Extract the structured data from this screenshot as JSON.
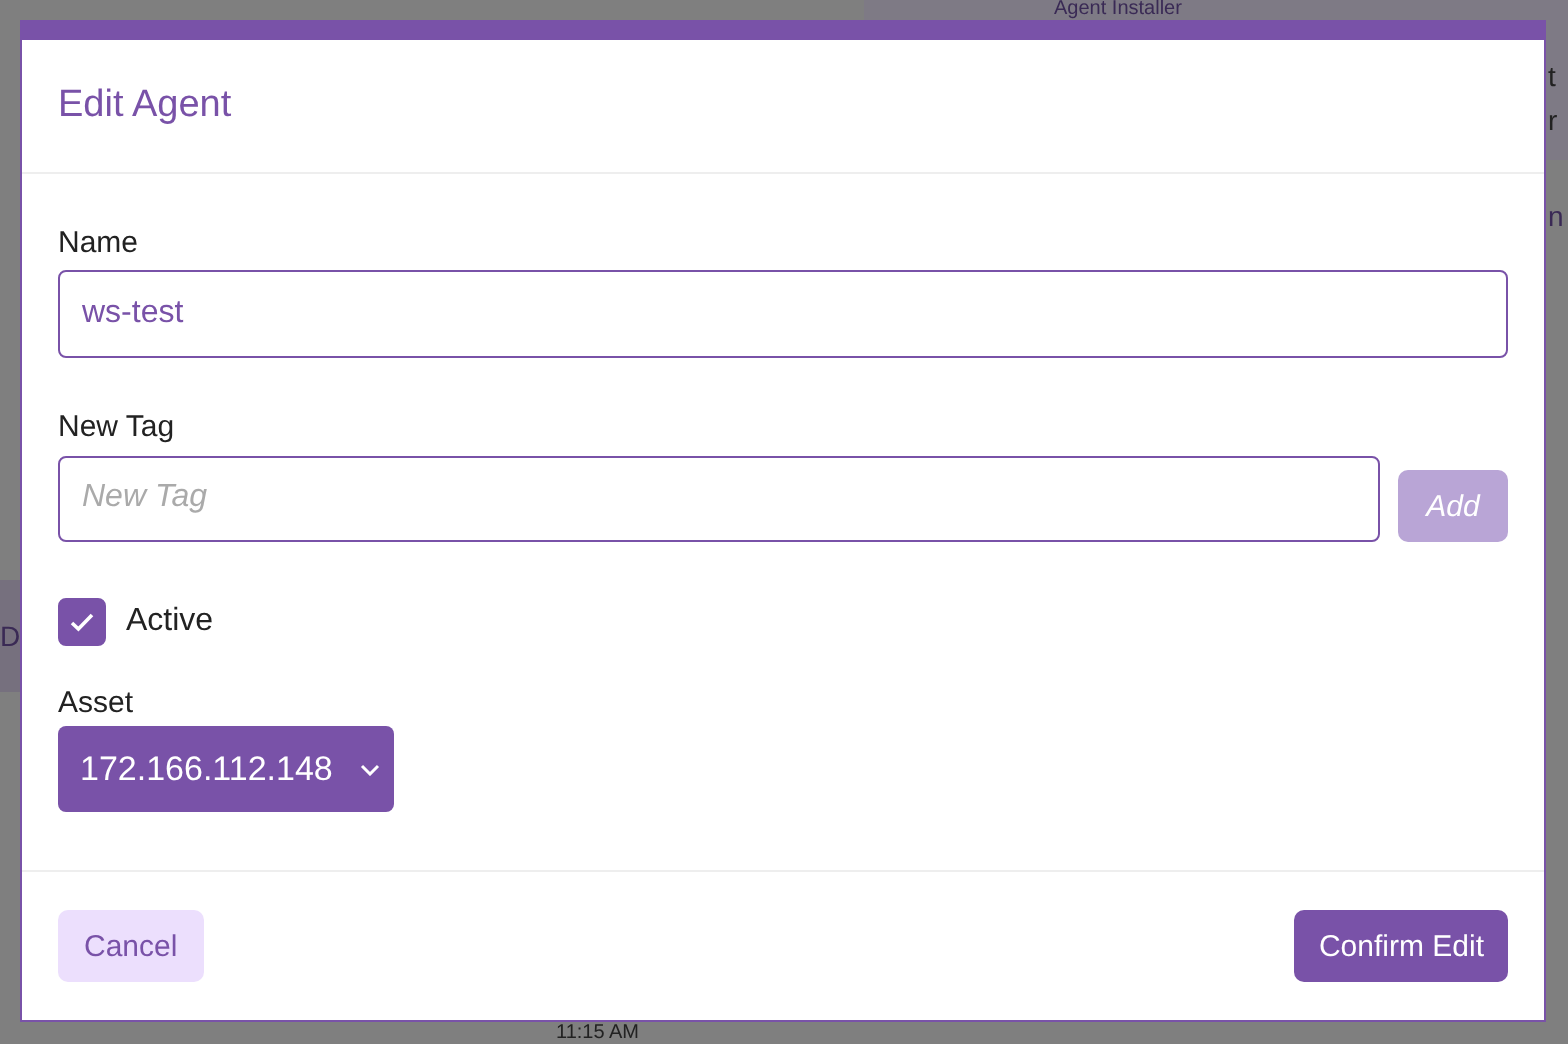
{
  "background": {
    "panel_title": "Agent Installer",
    "right_fragments": [
      "t",
      "r",
      "n"
    ],
    "left_fragment": "D",
    "time": "11:15 AM"
  },
  "dialog": {
    "title": "Edit Agent",
    "name": {
      "label": "Name",
      "value": "ws-test"
    },
    "new_tag": {
      "label": "New Tag",
      "placeholder": "New Tag",
      "button": "Add",
      "disabled": true
    },
    "active": {
      "label": "Active",
      "checked": true
    },
    "asset": {
      "label": "Asset",
      "value": "172.166.112.148"
    },
    "buttons": {
      "cancel": "Cancel",
      "confirm": "Confirm Edit"
    }
  }
}
